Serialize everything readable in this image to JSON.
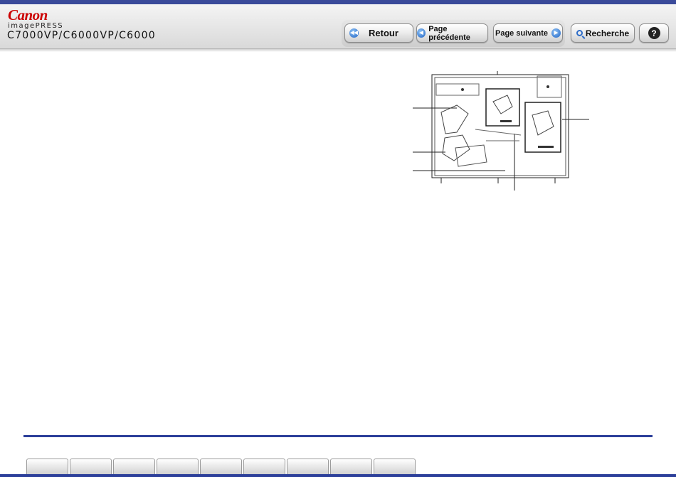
{
  "header": {
    "brand": "Canon",
    "product": "imagePRESS",
    "model": "C7000VP/C6000VP/C6000"
  },
  "toolbar": {
    "back_label": "Retour",
    "prev_label": "Page précédente",
    "next_label": "Page suivante",
    "search_label": "Recherche",
    "help_label": "?"
  },
  "icons": {
    "back": "double-left-arrow-icon",
    "prev": "left-arrow-icon",
    "next": "right-arrow-icon",
    "search": "magnifier-icon",
    "help": "question-icon"
  },
  "colors": {
    "brand_red": "#cc0000",
    "accent_blue": "#2c3f9a",
    "button_icon_blue": "#1f63c4"
  },
  "footer": {
    "tabs": [
      "",
      "",
      "",
      "",
      "",
      "",
      "",
      "",
      ""
    ]
  }
}
